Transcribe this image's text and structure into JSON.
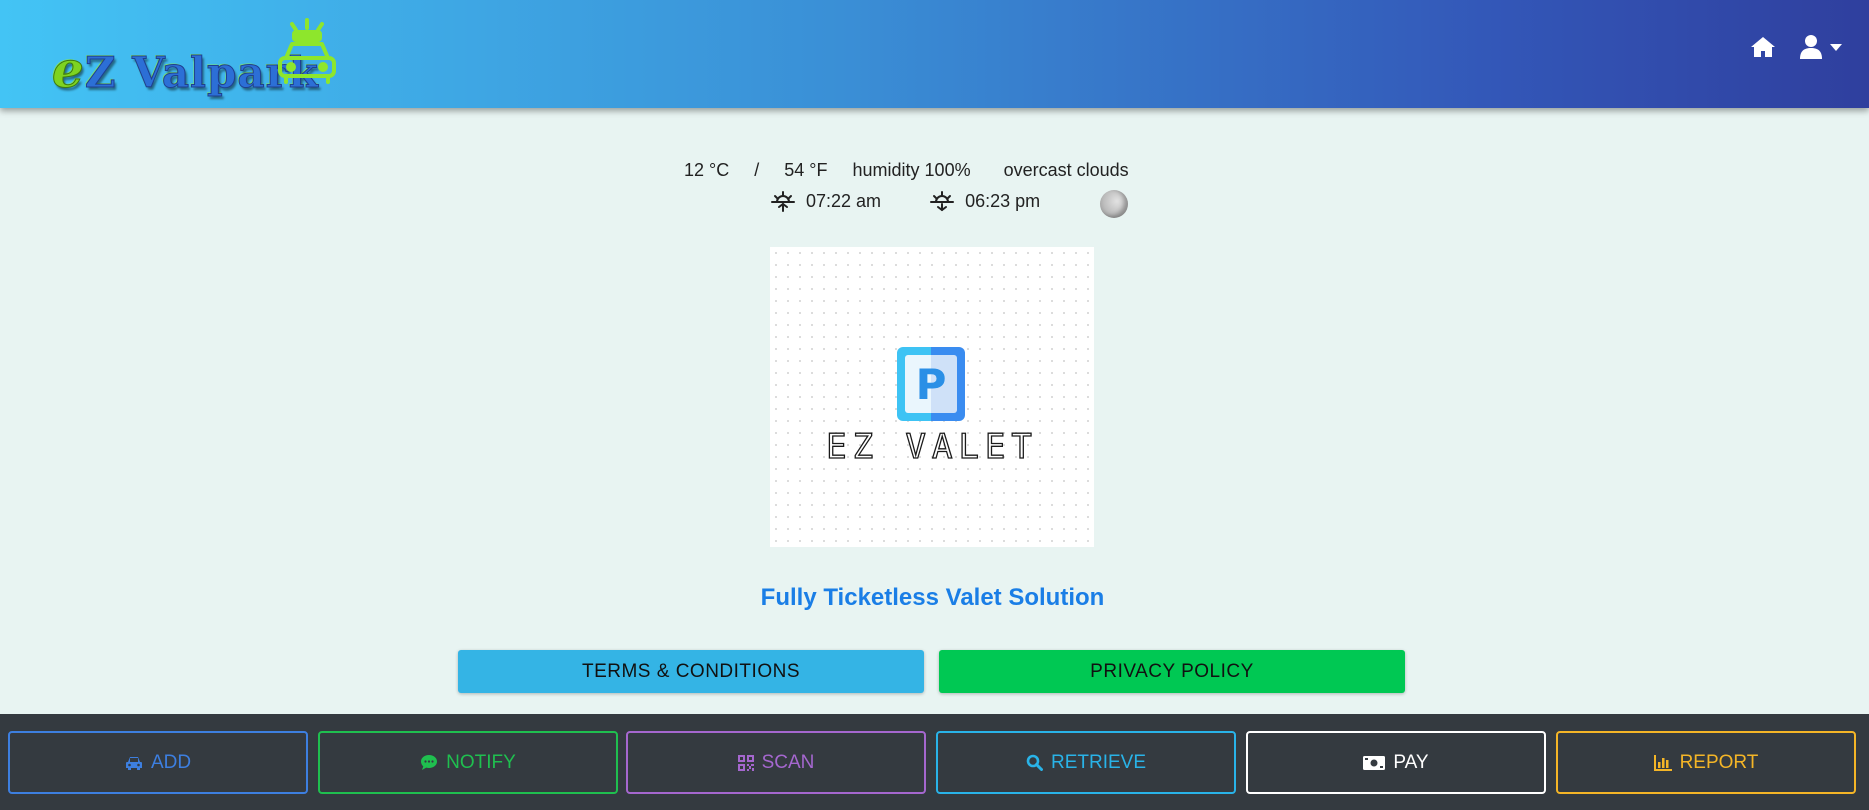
{
  "header": {
    "logo": {
      "prefix": "e",
      "text": "Z Valpark"
    },
    "nav": {
      "home_icon": "home-icon",
      "user_icon": "user-icon",
      "caret_icon": "caret-down-icon"
    }
  },
  "weather": {
    "celsius": "12 °C",
    "separator": "/",
    "fahrenheit": "54 °F",
    "humidity": "humidity 100%",
    "condition": "overcast clouds",
    "sunrise": "07:22 am",
    "sunset": "06:23 pm",
    "moon_icon": "moon-phase-icon"
  },
  "brand": {
    "p_letter": "P",
    "name": "EZ VALET"
  },
  "tagline": "Fully Ticketless Valet Solution",
  "legal": {
    "terms_label": "TERMS & CONDITIONS",
    "privacy_label": "PRIVACY POLICY"
  },
  "actions": [
    {
      "label": "ADD",
      "icon": "car-icon",
      "color": "#3d7fe0"
    },
    {
      "label": "NOTIFY",
      "icon": "chat-icon",
      "color": "#1fbf4f"
    },
    {
      "label": "SCAN",
      "icon": "qr-code-icon",
      "color": "#a567cf"
    },
    {
      "label": "RETRIEVE",
      "icon": "search-icon",
      "color": "#29b3e8"
    },
    {
      "label": "PAY",
      "icon": "money-icon",
      "color": "#ffffff"
    },
    {
      "label": "REPORT",
      "icon": "bar-chart-icon",
      "color": "#f4b527"
    }
  ],
  "colors": {
    "header_start": "#43c4f5",
    "header_end": "#2f3f9e",
    "page_background": "#e8f4f2",
    "tagline": "#1a7ee6",
    "terms_button": "#34b4e5",
    "privacy_button": "#00c853",
    "bottom_bar": "#343a40"
  }
}
